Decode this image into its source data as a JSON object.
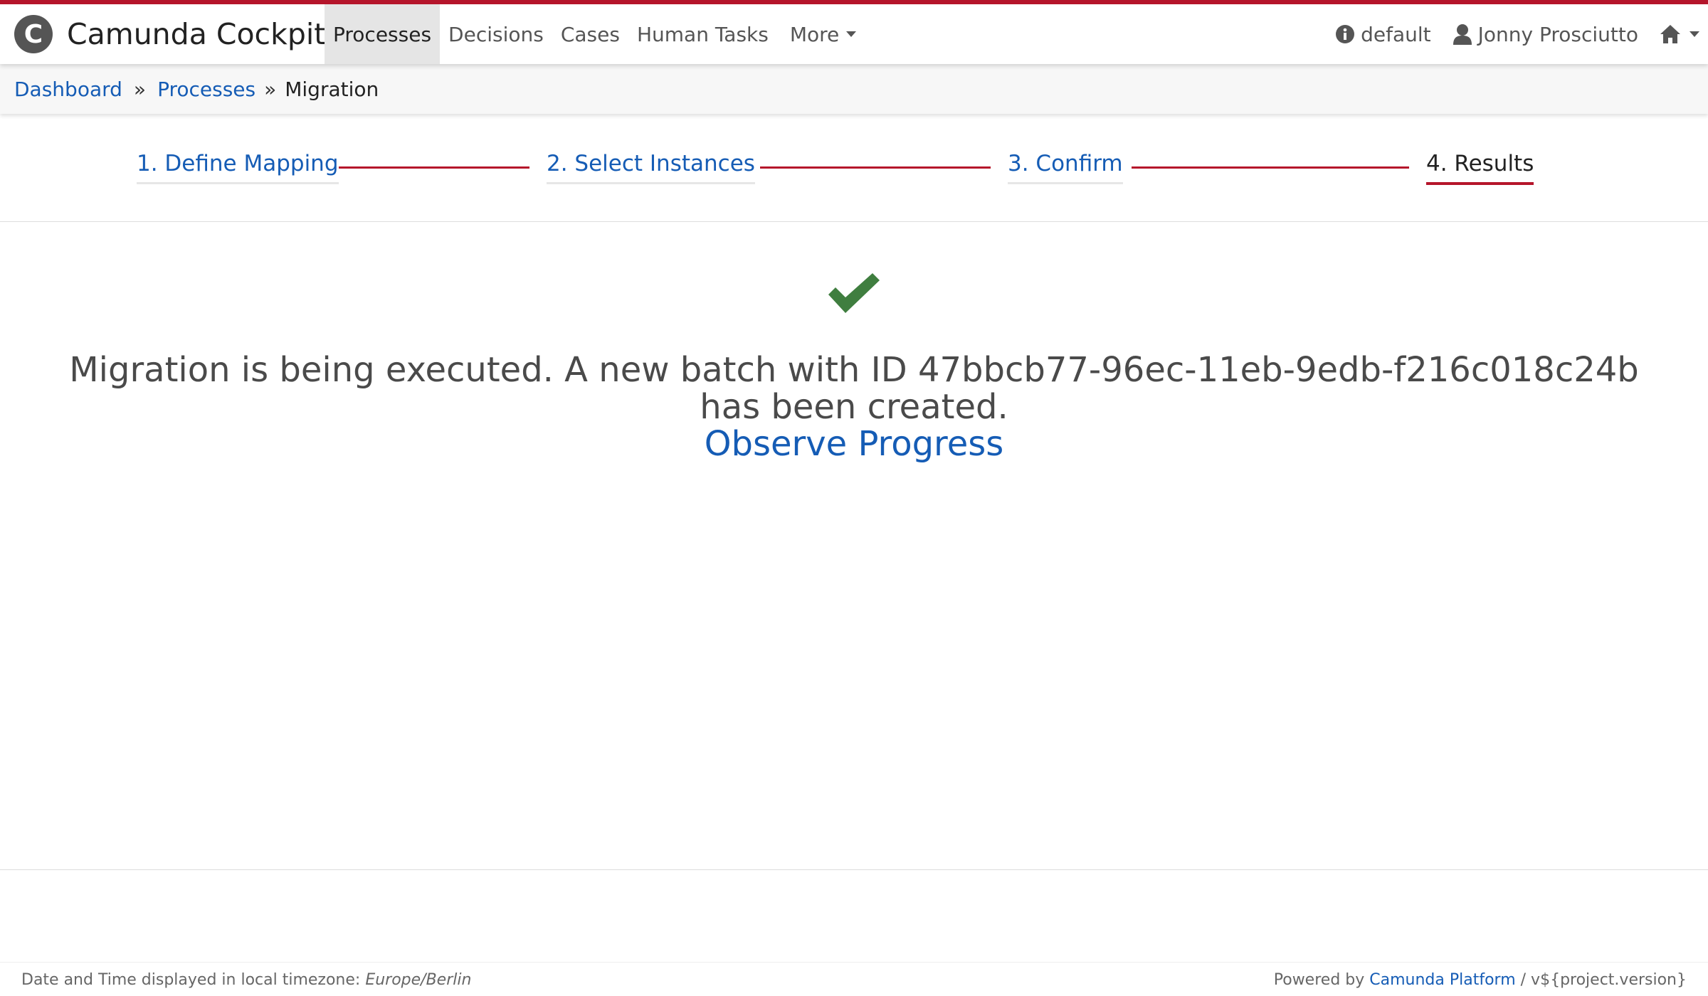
{
  "colors": {
    "accent_red": "#b5152b",
    "link_blue": "#155cb5",
    "success_green": "#3f7e3f"
  },
  "header": {
    "brand_logo_letter": "C",
    "brand_name": "Camunda Cockpit",
    "nav": [
      {
        "label": "Processes",
        "active": true
      },
      {
        "label": "Decisions"
      },
      {
        "label": "Cases"
      },
      {
        "label": "Human Tasks"
      },
      {
        "label": "More"
      }
    ],
    "engine": {
      "icon": "info-icon",
      "label": "default"
    },
    "user": {
      "icon": "user-icon",
      "label": "Jonny Prosciutto"
    },
    "home_icon": "home-icon"
  },
  "breadcrumb": {
    "items": [
      {
        "label": "Dashboard"
      },
      {
        "label": "Processes"
      },
      {
        "label": "Migration"
      }
    ],
    "separator": "»"
  },
  "wizard": {
    "steps": [
      {
        "label": "1. Define Mapping"
      },
      {
        "label": "2. Select Instances"
      },
      {
        "label": "3. Confirm"
      },
      {
        "label": "4. Results",
        "current": true
      }
    ]
  },
  "result": {
    "icon": "checkmark-icon",
    "message": "Migration is being executed. A new batch with ID 47bbcb77-96ec-11eb-9edb-f216c018c24b has been created.",
    "link_label": "Observe Progress"
  },
  "footer": {
    "timezone_prefix": "Date and Time displayed in local timezone:",
    "timezone": "Europe/Berlin",
    "powered_prefix": "Powered by",
    "powered_link": "Camunda Platform",
    "version": "/ v${project.version}"
  }
}
